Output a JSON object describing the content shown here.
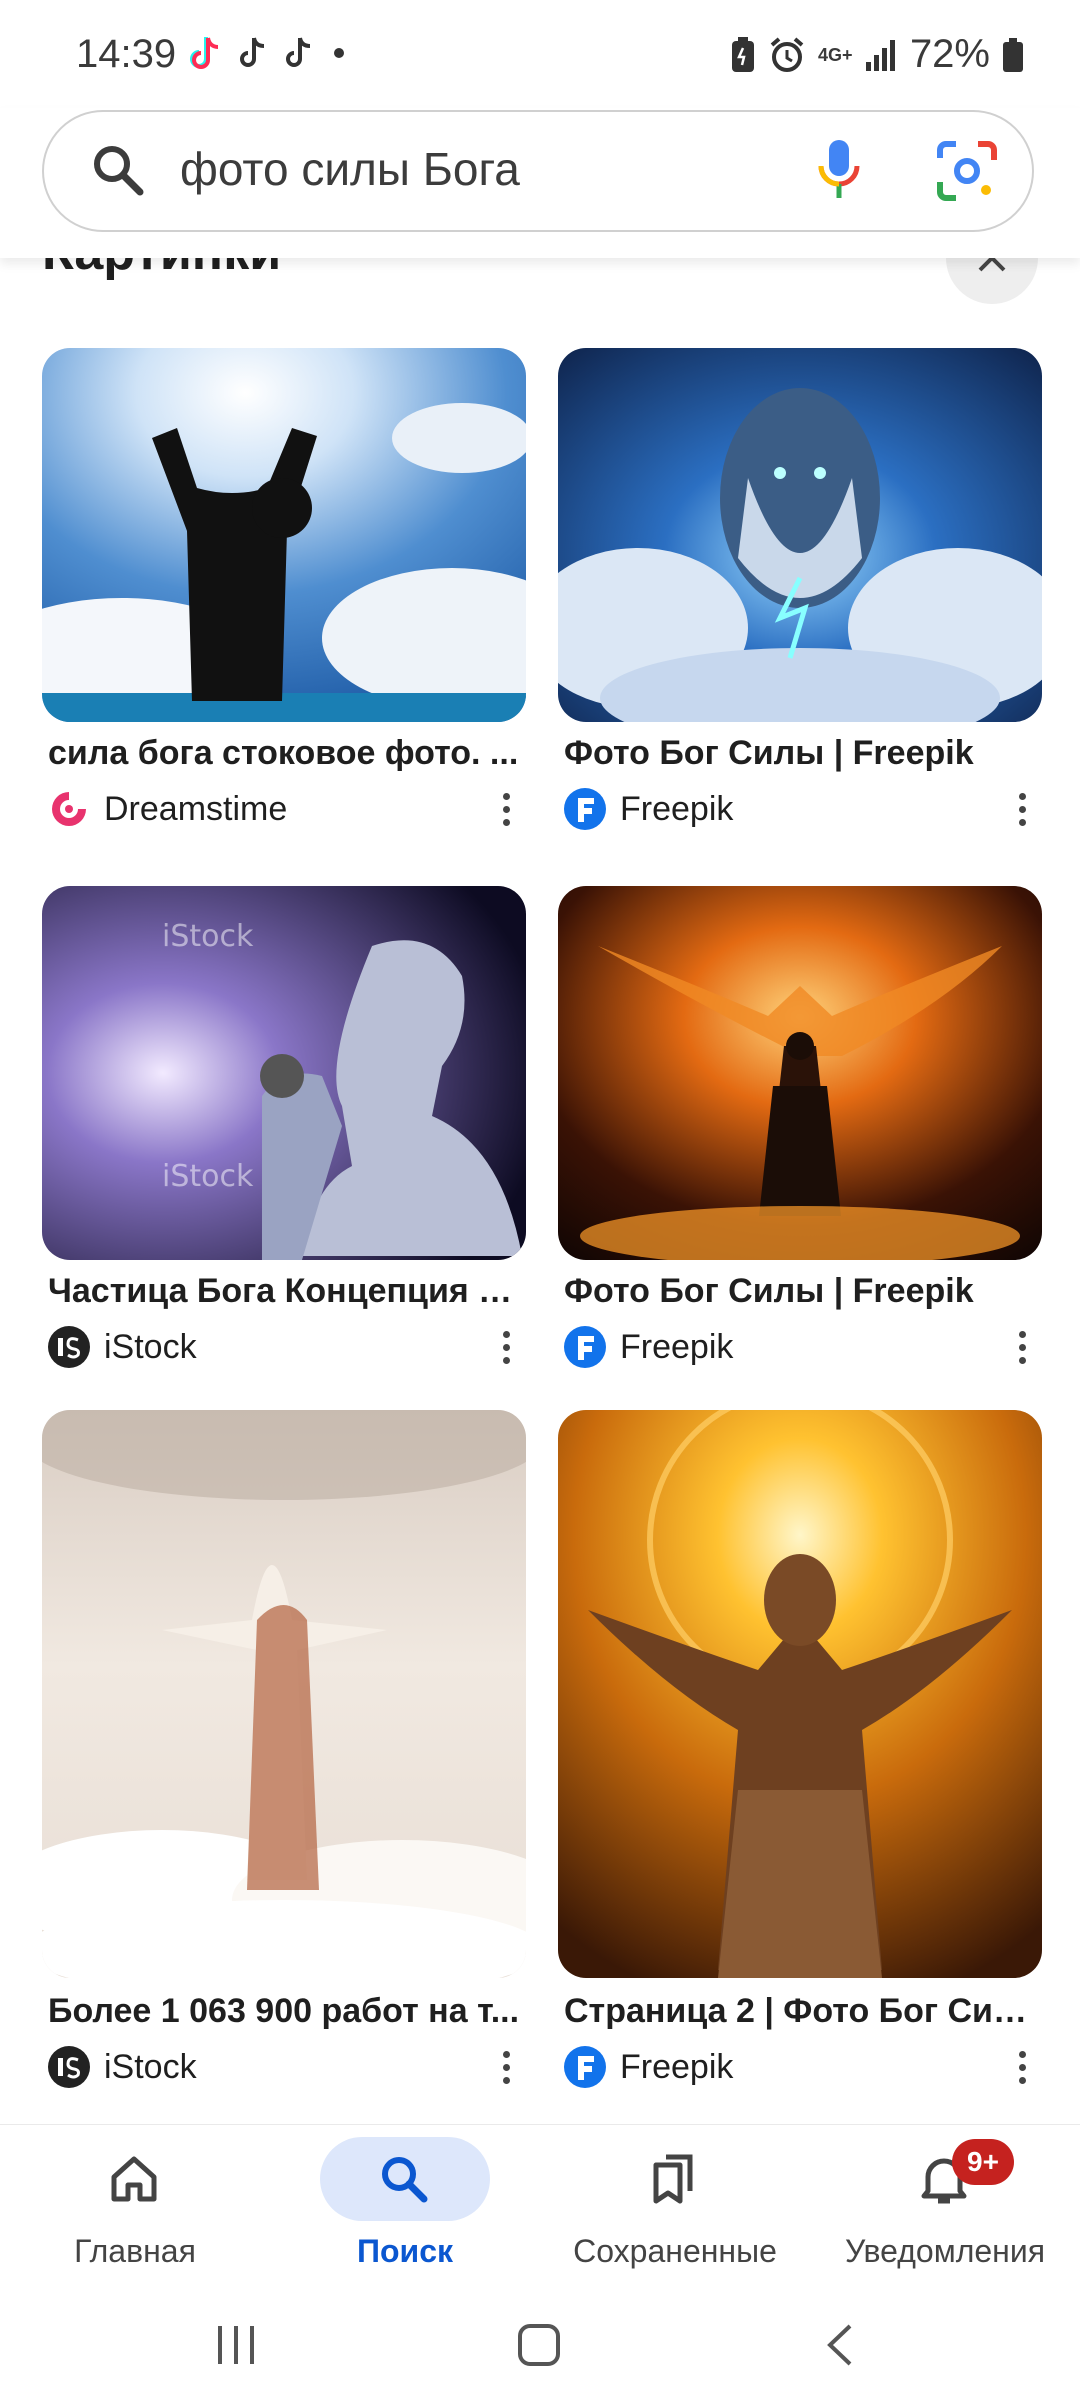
{
  "status_bar": {
    "time": "14:39",
    "network": "4G+",
    "battery": "72%"
  },
  "search": {
    "query": "фото силы Бога"
  },
  "section": {
    "title": "Картинки"
  },
  "results": [
    {
      "title": "сила бога стоковое фото. ...",
      "source": "Dreamstime",
      "source_logo_color": "#e8336e"
    },
    {
      "title": "Фото Бог Силы | Freepik",
      "source": "Freepik",
      "source_logo_color": "#1273eb"
    },
    {
      "title": "Частица Бога Концепция Н...",
      "source": "iStock",
      "source_logo_color": "#222222"
    },
    {
      "title": "Фото Бог Силы | Freepik",
      "source": "Freepik",
      "source_logo_color": "#1273eb"
    },
    {
      "title": "Более 1 063 900 работ на т...",
      "source": "iStock",
      "source_logo_color": "#222222"
    },
    {
      "title": "Страница 2 | Фото Бог Сил...",
      "source": "Freepik",
      "source_logo_color": "#1273eb"
    }
  ],
  "bottom_nav": {
    "items": [
      {
        "label": "Главная",
        "icon": "home-icon"
      },
      {
        "label": "Поиск",
        "icon": "search-icon"
      },
      {
        "label": "Сохраненные",
        "icon": "bookmarks-icon"
      },
      {
        "label": "Уведомления",
        "icon": "bell-icon"
      }
    ],
    "notifications_badge": "9+"
  },
  "colors": {
    "accent": "#0b57d0",
    "active_nav_bg": "#dde7fb",
    "badge": "#c5221f"
  }
}
